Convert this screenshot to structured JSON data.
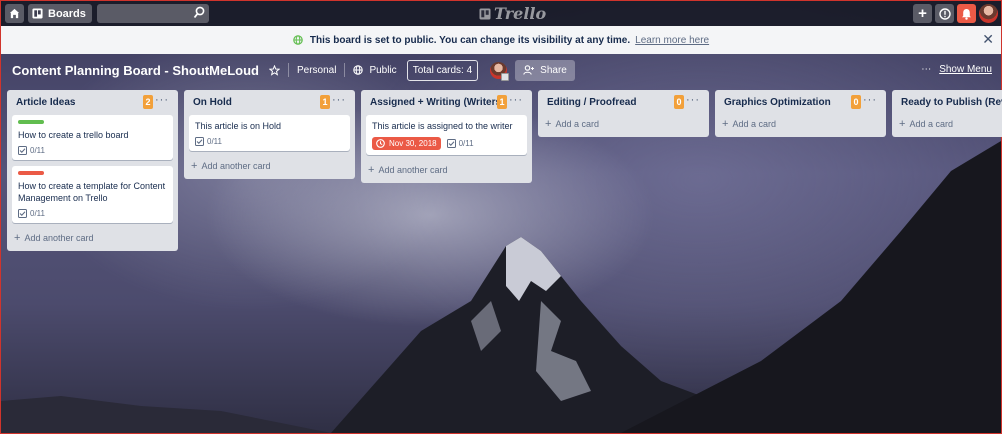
{
  "topbar": {
    "boards_label": "Boards",
    "search_value": "",
    "logo_text": "Trello",
    "icons": [
      "home-icon",
      "boards-icon",
      "search-icon",
      "add-icon",
      "info-icon",
      "bell-icon",
      "avatar"
    ]
  },
  "banner": {
    "message": "This board is set to public. You can change its visibility at any time.",
    "link": "Learn more here",
    "accent_color": "#61bd4f"
  },
  "board": {
    "title": "Content Planning Board - ShoutMeLoud",
    "team": "Personal",
    "visibility": "Public",
    "total_cards": "Total cards: 4",
    "share_label": "Share",
    "menu_label": "Show Menu"
  },
  "lists": [
    {
      "title": "Article Ideas",
      "count": "2",
      "add_label": "Add another card",
      "cards": [
        {
          "title": "How to create a trello board",
          "label_color": "#61bd4f",
          "checklist": "0/11"
        },
        {
          "title": "How to create a template for Content Management on Trello",
          "label_color": "#eb5a46",
          "checklist": "0/11"
        }
      ]
    },
    {
      "title": "On Hold",
      "count": "1",
      "add_label": "Add another card",
      "cards": [
        {
          "title": "This article is on Hold",
          "checklist": "0/11"
        }
      ]
    },
    {
      "title": "Assigned + Writing (Writers)",
      "count": "1",
      "add_label": "Add another card",
      "cards": [
        {
          "title": "This article is assigned to the writer",
          "due": "Nov 30, 2018",
          "due_color": "#eb5a46",
          "checklist": "0/11"
        }
      ]
    },
    {
      "title": "Editing / Proofread",
      "count": "0",
      "add_label": "Add a card",
      "cards": []
    },
    {
      "title": "Graphics Optimization",
      "count": "0",
      "add_label": "Add a card",
      "cards": []
    },
    {
      "title": "Ready to Publish (Review)",
      "count": "",
      "add_label": "Add a card",
      "cards": []
    }
  ]
}
